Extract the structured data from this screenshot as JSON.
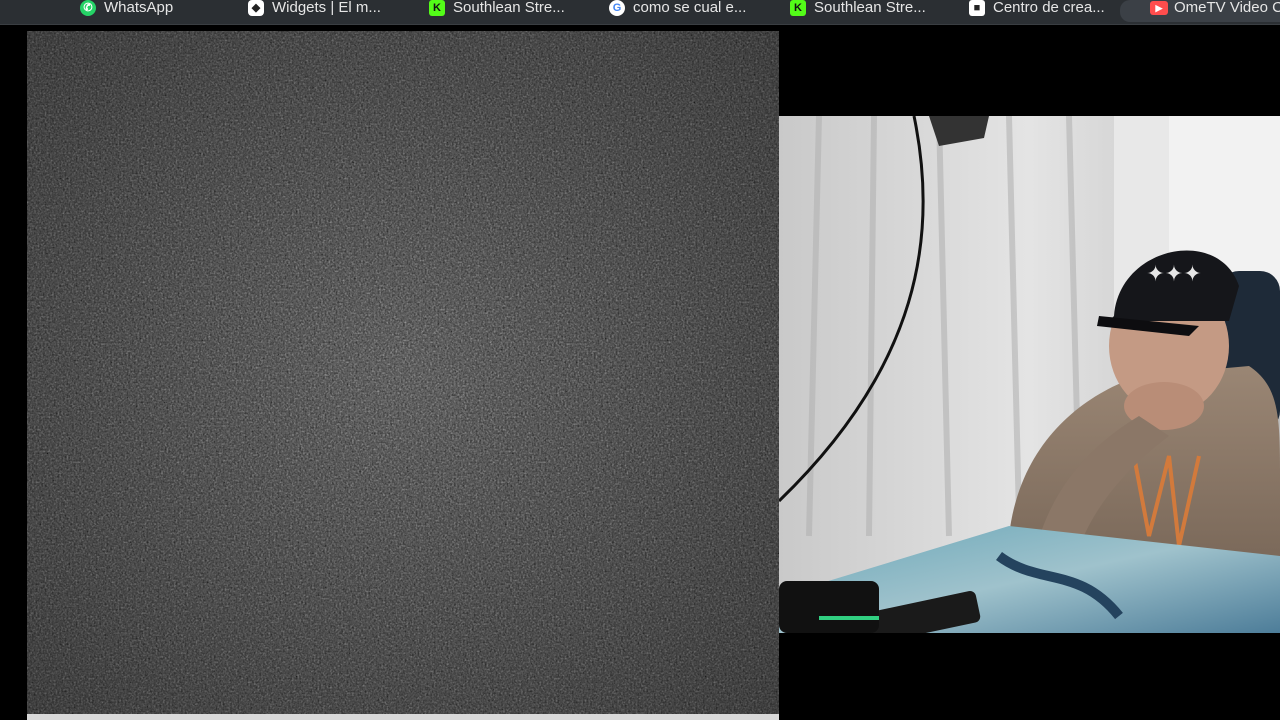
{
  "bookmarks": [
    {
      "label": "WhatsApp",
      "icon": "whatsapp-icon",
      "icon_color": "#25d366"
    },
    {
      "label": "Widgets | El m...",
      "icon": "widgets-icon",
      "icon_color": "#ffffff"
    },
    {
      "label": "Southlean Stre...",
      "icon": "kick-icon",
      "icon_color": "#53fc18"
    },
    {
      "label": "como se cual e...",
      "icon": "google-icon",
      "icon_color": "#ffffff"
    },
    {
      "label": "Southlean Stre...",
      "icon": "kick-icon",
      "icon_color": "#53fc18"
    },
    {
      "label": "Centro de crea...",
      "icon": "roblox-icon",
      "icon_color": "#ffffff"
    },
    {
      "label": "OmeTV Video C",
      "icon": "ometv-icon",
      "icon_color": "#ff4d4d"
    }
  ],
  "colors": {
    "bookmarks_bar": "#2b2f33",
    "static_base": "#3d3d3d",
    "page_background": "#000000"
  }
}
